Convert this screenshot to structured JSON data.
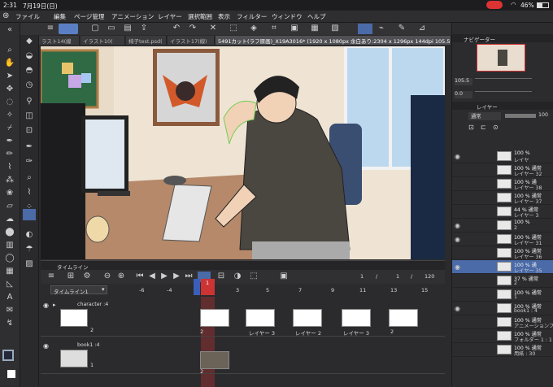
{
  "status": {
    "time": "2:31",
    "date": "7月19日(日)",
    "battery": "46%"
  },
  "menu": {
    "items": [
      "ファイル",
      "編集",
      "ページ管理",
      "アニメーション",
      "レイヤー",
      "選択範囲",
      "表示",
      "フィルター",
      "ウィンドウ",
      "ヘルプ"
    ]
  },
  "tabs": [
    "ラスト14(線",
    "イラスト10(",
    "椅子test.psd(",
    "イラスト17(線)",
    "5491カット(ラフ原画)_X19A3016* (1920 x 1080px 余白あり:2304 x 1296px 144dpi 105.5%)"
  ],
  "timeline": {
    "title": "タイムライン",
    "dropdown": "タイムライン1",
    "frame_numbers": [
      "-1",
      "1",
      "3",
      "5",
      "7",
      "9",
      "11",
      "13",
      "15"
    ],
    "neg_labels": [
      "-6",
      "-4",
      "-2"
    ],
    "current_frame": "1",
    "counter": [
      "1",
      "/",
      "1",
      "/",
      "120"
    ],
    "track1": "character :4",
    "track2": "book1 :4",
    "track1_num": "2",
    "track2_num": "1",
    "cels": [
      "2",
      "レイヤー 3",
      "レイヤー 2",
      "レイヤー 3",
      "2"
    ],
    "cel2": "2"
  },
  "navigator": {
    "title": "ナビゲーター",
    "zoom": "105.5",
    "angle": "0.0"
  },
  "layer": {
    "title": "レイヤー",
    "blend": "通常",
    "opacity": "100",
    "rows": [
      {
        "l1": "100 %",
        "l2": "レイヤ"
      },
      {
        "l1": "100 % 通常",
        "l2": "レイヤー 32"
      },
      {
        "l1": "100 % 通",
        "l2": "レイヤー 38"
      },
      {
        "l1": "100 % 通常",
        "l2": "レイヤー 37"
      },
      {
        "l1": "44 % 通常",
        "l2": "レイヤー 3"
      },
      {
        "l1": "100 %",
        "l2": "2"
      },
      {
        "l1": "100 % 通常",
        "l2": "レイヤー 31"
      },
      {
        "l1": "100 % 通常",
        "l2": "レイヤー 36"
      },
      {
        "l1": "100 % 通",
        "l2": "レイヤー 35"
      },
      {
        "l1": "37 % 通常",
        "l2": "2"
      },
      {
        "l1": "100 % 通常",
        "l2": "1"
      },
      {
        "l1": "100 % 通常",
        "l2": "book1 : 4"
      },
      {
        "l1": "100 % 通常",
        "l2": "アニメーションフォルダ"
      },
      {
        "l1": "100 % 通常",
        "l2": "フォルダー 1 : 1"
      },
      {
        "l1": "100 % 通常",
        "l2": "用紙 : 30"
      }
    ]
  },
  "colors": {
    "accent": "#4a7bd4",
    "selected": "#4a6aa8",
    "red": "#c33"
  }
}
